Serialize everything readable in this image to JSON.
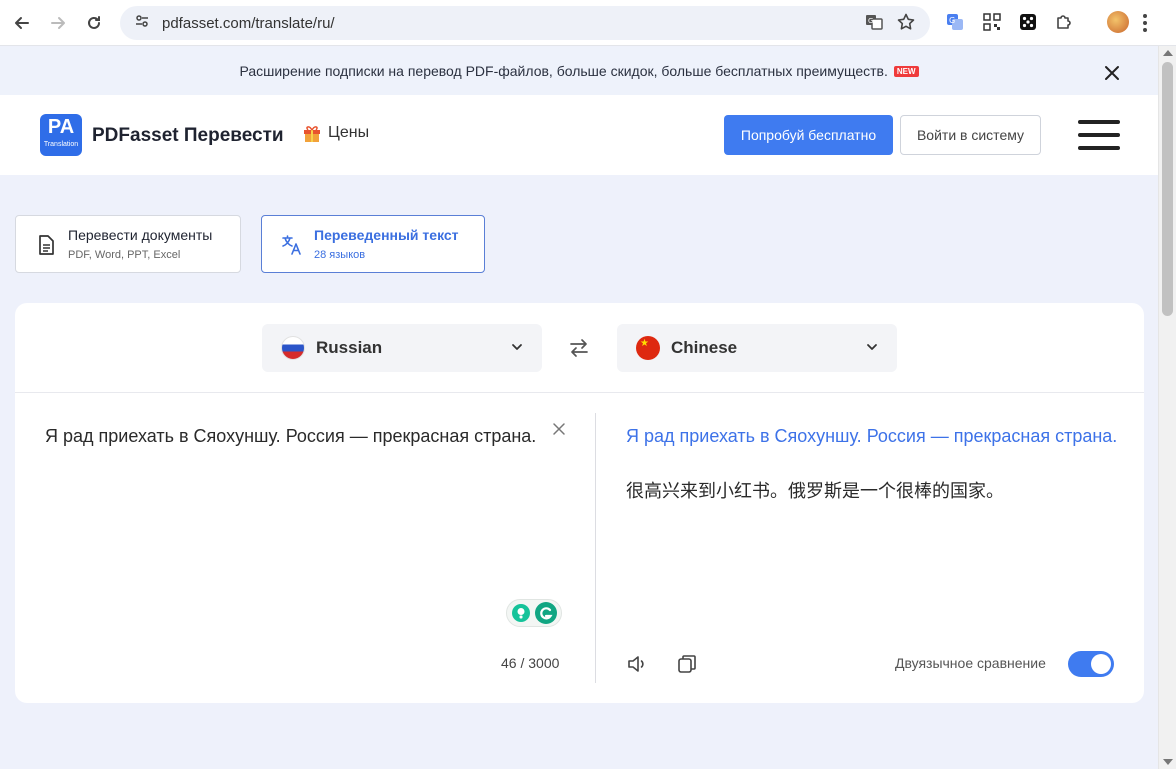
{
  "browser": {
    "url": "pdfasset.com/translate/ru/",
    "icons": [
      "back-icon",
      "forward-icon",
      "reload-icon",
      "site-info-icon",
      "translate-page-icon",
      "bookmark-star-icon",
      "extension-translate-icon",
      "extension-qr-icon",
      "extension-dice-icon",
      "extensions-puzzle-icon",
      "profile-avatar",
      "menu-kebab-icon"
    ]
  },
  "banner": {
    "text": "Расширение подписки на перевод PDF-файлов, больше скидок, больше бесплатных преимуществ.",
    "badge": "NEW"
  },
  "header": {
    "logo_main": "PA",
    "logo_sub": "Translation",
    "brand": "PDFasset Перевести",
    "pricing_label": "Цены",
    "try_free_label": "Попробуй бесплатно",
    "login_label": "Войти в систему"
  },
  "modes": [
    {
      "title": "Перевести документы",
      "subtitle": "PDF, Word, PPT, Excel",
      "active": false
    },
    {
      "title": "Переведенный текст",
      "subtitle": "28 языков",
      "active": true
    }
  ],
  "translator": {
    "source_lang": "Russian",
    "target_lang": "Chinese",
    "source_text": "Я рад приехать в Сяохуншу. Россия — прекрасная страна.",
    "char_count": "46 / 3000",
    "target_original": "Я рад приехать в Сяохуншу. Россия — прекрасная страна.",
    "target_translation": "很高兴来到小红书。俄罗斯是一个很棒的国家。",
    "bilingual_label": "Двуязычное сравнение",
    "bilingual_enabled": true
  },
  "colors": {
    "accent": "#3f7bf0",
    "translated_link_blue": "#3d72e8",
    "page_bg": "#eef1fb"
  }
}
